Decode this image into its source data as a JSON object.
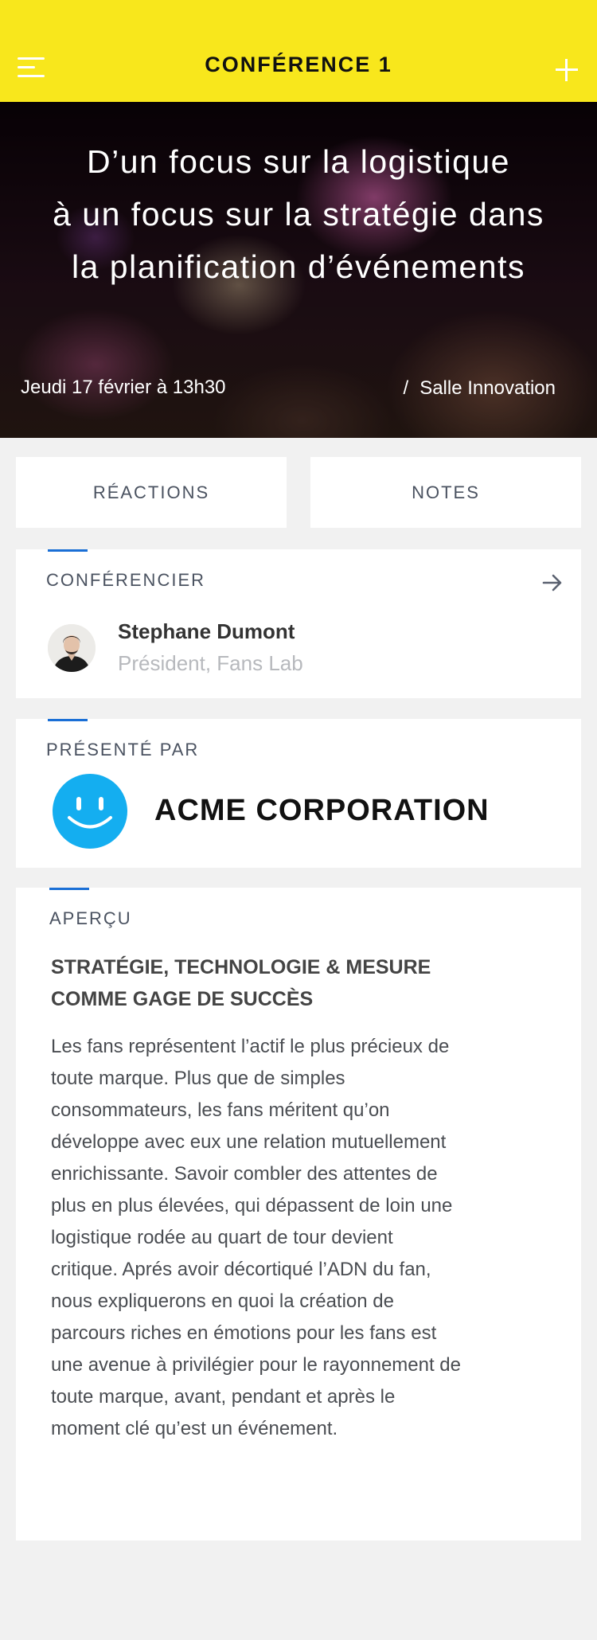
{
  "header": {
    "title": "CONFÉRENCE 1",
    "menu_icon": "menu-icon",
    "add_icon": "plus-icon",
    "background_color": "#f8e71c"
  },
  "hero": {
    "title": "D’un focus sur la logistique\nà un focus sur la stratégie dans\nla planification d’événements",
    "date": "Jeudi 17 février à 13h30",
    "separator": "/",
    "room": "Salle Innovation"
  },
  "tabs": [
    {
      "label": "RÉACTIONS"
    },
    {
      "label": "NOTES"
    }
  ],
  "speaker_section": {
    "label": "CONFÉRENCIER",
    "arrow_icon": "arrow-right-icon",
    "name": "Stephane Dumont",
    "role": "Président, Fans Lab"
  },
  "sponsor_section": {
    "label": "PRÉSENTÉ PAR",
    "logo_icon": "smiley-logo-icon",
    "name": "ACME CORPORATION"
  },
  "overview_section": {
    "label": "APERÇU",
    "heading": "STRATÉGIE, TECHNOLOGIE & MESURE\nCOMME GAGE DE SUCCÈS",
    "body": "Les fans représentent l’actif le plus précieux de\ntoute marque. Plus que de simples\nconsommateurs, les fans méritent qu’on\ndéveloppe avec eux une relation mutuellement\nenrichissante. Savoir combler des attentes de\nplus en plus élevées, qui dépassent de loin une\nlogistique rodée au quart de tour devient\ncritique. Aprés avoir décortiqué l’ADN du fan,\nnous expliquerons en quoi la création de\nparcours riches en émotions pour les fans est\nune avenue à privilégier pour le rayonnement de\ntoute marque, avant, pendant et après le\nmoment clé qu’est un événement."
  },
  "colors": {
    "accent": "#1a6fd6",
    "logo": "#14aef0"
  }
}
